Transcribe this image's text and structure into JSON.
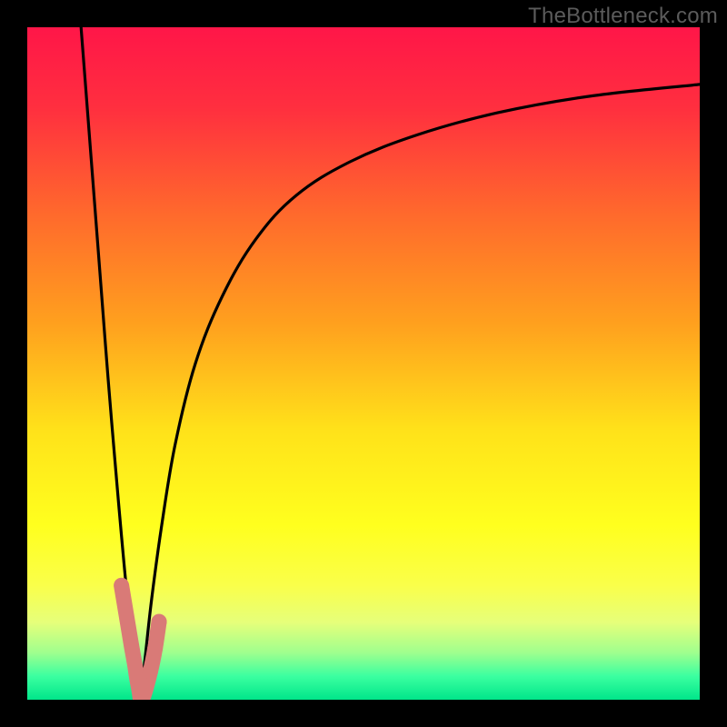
{
  "watermark": "TheBottleneck.com",
  "colors": {
    "frame": "#000000",
    "curve": "#000000",
    "marker_fill": "#d97a77",
    "marker_stroke": "#c96863",
    "gradient_stops": [
      {
        "offset": 0.0,
        "color": "#ff1648"
      },
      {
        "offset": 0.12,
        "color": "#ff2f3f"
      },
      {
        "offset": 0.28,
        "color": "#ff6a2c"
      },
      {
        "offset": 0.44,
        "color": "#ffa01e"
      },
      {
        "offset": 0.6,
        "color": "#ffe21a"
      },
      {
        "offset": 0.74,
        "color": "#ffff1e"
      },
      {
        "offset": 0.83,
        "color": "#faff4a"
      },
      {
        "offset": 0.885,
        "color": "#e6ff7a"
      },
      {
        "offset": 0.93,
        "color": "#9fff8e"
      },
      {
        "offset": 0.965,
        "color": "#3bffa0"
      },
      {
        "offset": 1.0,
        "color": "#00e68a"
      }
    ]
  },
  "chart_data": {
    "type": "line",
    "title": "",
    "xlabel": "",
    "ylabel": "",
    "xlim": [
      0,
      100
    ],
    "ylim": [
      0,
      100
    ],
    "grid": false,
    "legend": false,
    "series": [
      {
        "name": "left-curve",
        "x": [
          8.0,
          9.0,
          10.0,
          11.0,
          12.0,
          13.0,
          14.0,
          15.0,
          16.0,
          16.5,
          16.8
        ],
        "y": [
          100.0,
          87.0,
          74.0,
          61.0,
          48.0,
          36.0,
          24.5,
          14.0,
          6.0,
          2.0,
          0.0
        ]
      },
      {
        "name": "right-curve",
        "x": [
          16.8,
          17.5,
          18.5,
          20.0,
          22.0,
          25.0,
          29.0,
          34.0,
          40.0,
          48.0,
          58.0,
          70.0,
          84.0,
          100.0
        ],
        "y": [
          0.0,
          6.0,
          15.0,
          26.0,
          38.0,
          50.0,
          60.0,
          68.5,
          75.0,
          80.0,
          84.0,
          87.3,
          89.8,
          91.5
        ]
      }
    ],
    "markers": {
      "name": "highlight-points",
      "x": [
        14.0,
        14.5,
        15.0,
        15.5,
        16.0,
        16.3,
        16.6,
        16.8,
        17.3,
        18.3,
        19.0,
        19.6
      ],
      "y": [
        17.0,
        14.0,
        11.0,
        8.0,
        5.2,
        3.2,
        1.6,
        0.3,
        0.6,
        4.2,
        7.6,
        11.6
      ]
    }
  }
}
